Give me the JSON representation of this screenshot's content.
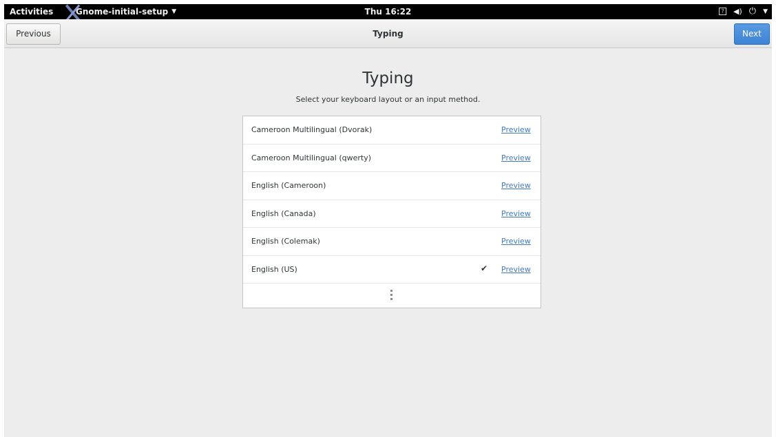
{
  "topbar": {
    "activities": "Activities",
    "app_name": "Gnome-initial-setup",
    "app_caret": "▼",
    "clock": "Thu 16:22",
    "help_glyph": "?",
    "volume_glyph": "◀)",
    "power_glyph": "⏻",
    "menu_caret": "▼"
  },
  "header": {
    "title": "Typing",
    "previous_label": "Previous",
    "next_label": "Next"
  },
  "page": {
    "heading": "Typing",
    "subtitle": "Select your keyboard layout or an input method."
  },
  "layouts": [
    {
      "name": "Cameroon Multilingual (Dvorak)",
      "preview": "Preview",
      "selected": false
    },
    {
      "name": "Cameroon Multilingual (qwerty)",
      "preview": "Preview",
      "selected": false
    },
    {
      "name": "English (Cameroon)",
      "preview": "Preview",
      "selected": false
    },
    {
      "name": "English (Canada)",
      "preview": "Preview",
      "selected": false
    },
    {
      "name": "English (Colemak)",
      "preview": "Preview",
      "selected": false
    },
    {
      "name": "English (US)",
      "preview": "Preview",
      "selected": true,
      "check": "✔"
    }
  ],
  "colors": {
    "accent": "#3d84d6",
    "link": "#3f7ac4",
    "background": "#ededed",
    "topbar": "#000000"
  }
}
